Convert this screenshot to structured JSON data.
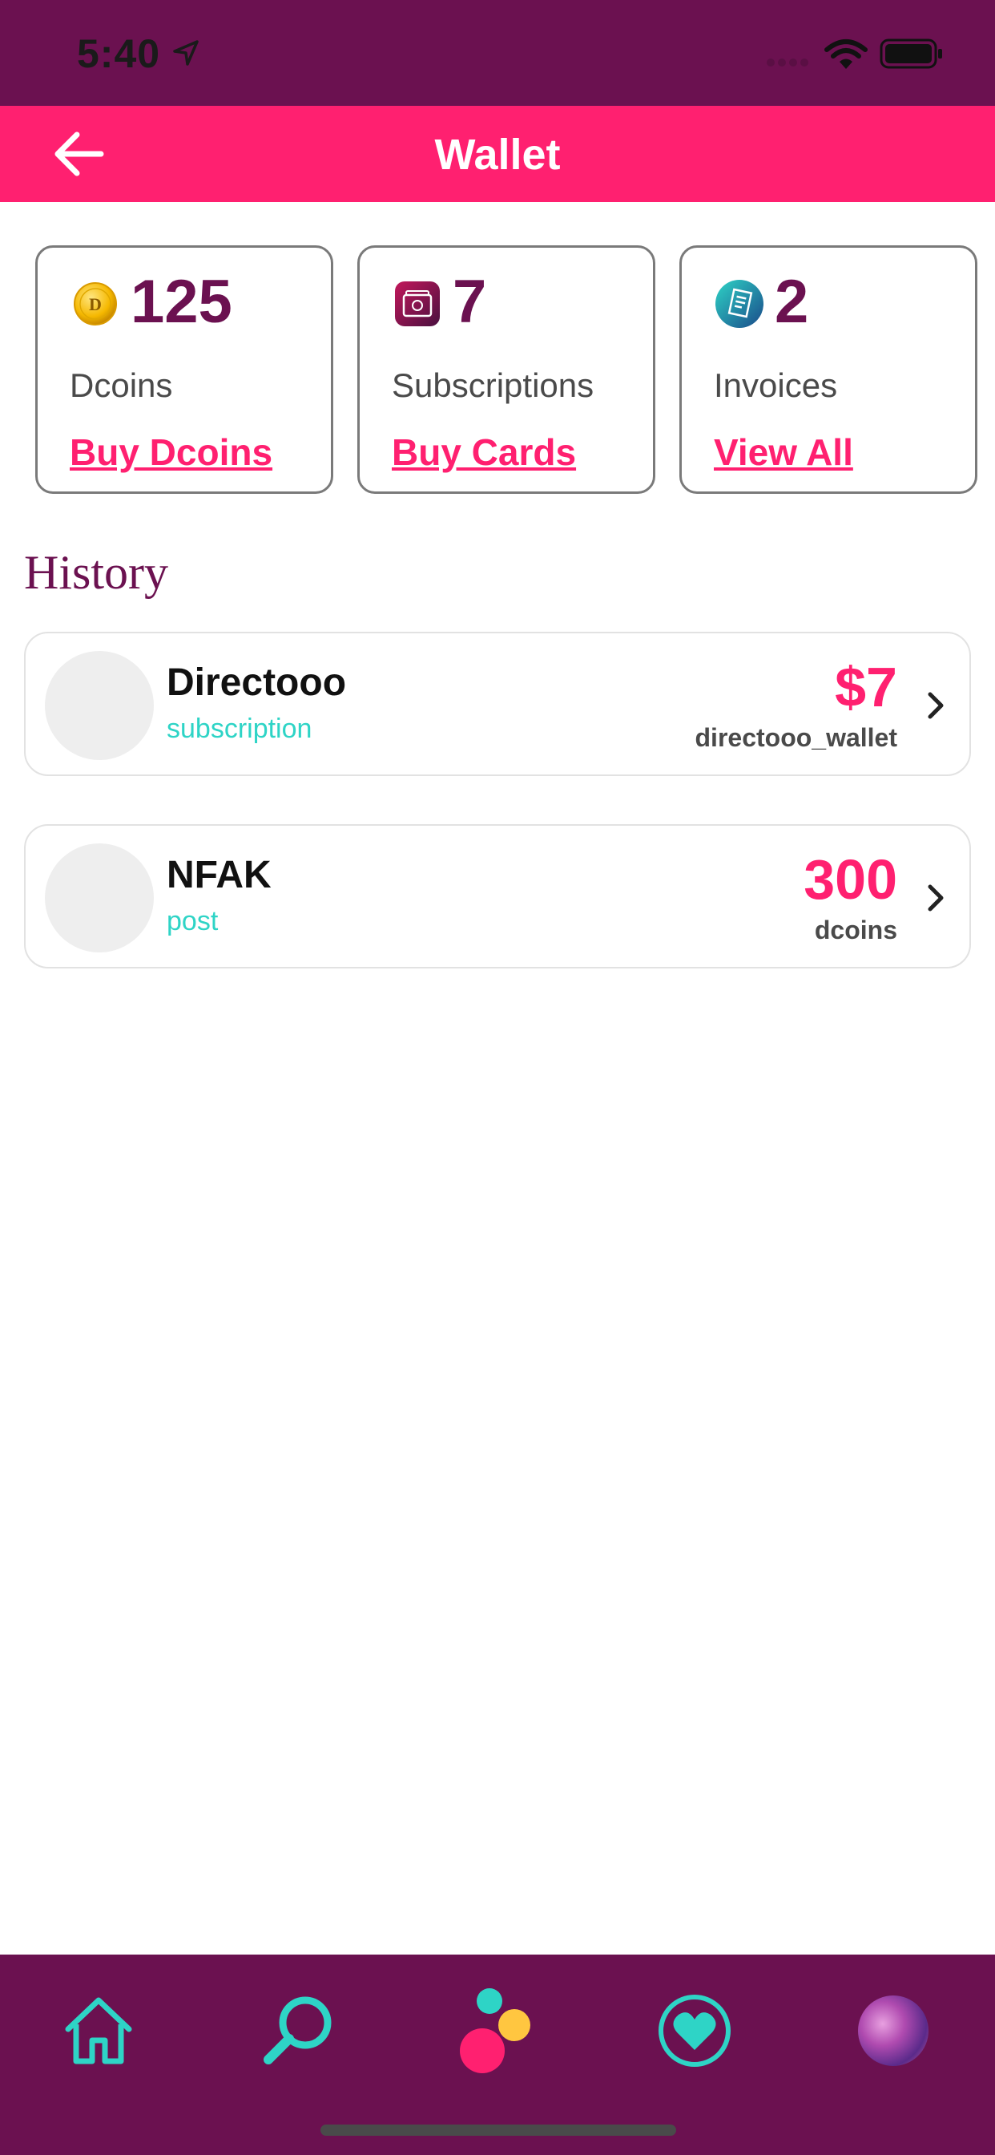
{
  "status_bar": {
    "time": "5:40"
  },
  "header": {
    "title": "Wallet"
  },
  "cards": [
    {
      "value": "125",
      "label": "Dcoins",
      "link": "Buy Dcoins",
      "coin_letter": "D"
    },
    {
      "value": "7",
      "label": "Subscriptions",
      "link": "Buy Cards"
    },
    {
      "value": "2",
      "label": "Invoices",
      "link": "View All"
    }
  ],
  "history": {
    "title": "History",
    "items": [
      {
        "name": "Directooo",
        "type": "subscription",
        "amount": "$7",
        "unit": "directooo_wallet"
      },
      {
        "name": "NFAK",
        "type": "post",
        "amount": "300",
        "unit": "dcoins"
      }
    ]
  },
  "colors": {
    "primary": "#ff2070",
    "dark": "#6b1150",
    "accent": "#2ed4c6",
    "yellow": "#ffc640"
  },
  "icons": {
    "card_1": "coin-icon",
    "card_2": "subscription-card-icon",
    "card_3": "invoice-icon",
    "nav": [
      "home-icon",
      "search-icon",
      "create-icon",
      "heart-icon",
      "profile-avatar"
    ]
  }
}
